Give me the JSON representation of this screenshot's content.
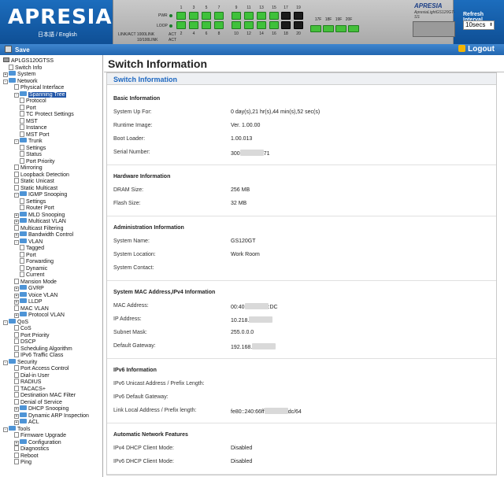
{
  "header": {
    "logo": "APRESIA",
    "language": "日本語 / English",
    "refresh_label": "Refresh Interval",
    "refresh_value": "10secs"
  },
  "device": {
    "brand": "APRESIA",
    "model": "ApresiaLightGS120GT-SS",
    "pwr_label": "PWR",
    "loop_label": "LOOP",
    "legend_1000": "LINK/ACT 1000LINK",
    "legend_1000_act": "ACT",
    "legend_100": "10/100LINK",
    "legend_100_act": "ACT",
    "port_top": [
      "1",
      "3",
      "5",
      "7",
      "9",
      "11",
      "13",
      "15",
      "17",
      "19"
    ],
    "port_bottom": [
      "2",
      "4",
      "6",
      "8",
      "10",
      "12",
      "14",
      "16",
      "18",
      "20"
    ],
    "sfp_labels": [
      "17F",
      "18F",
      "19F",
      "20F"
    ]
  },
  "toolbar": {
    "save": "Save",
    "logout": "Logout"
  },
  "tree": [
    {
      "label": "APLGS120GTSS",
      "indent": 0,
      "type": "device",
      "expander": ""
    },
    {
      "label": "Switch Info",
      "indent": 1,
      "type": "doc",
      "expander": ""
    },
    {
      "label": "System",
      "indent": 0,
      "type": "folder",
      "expander": "+"
    },
    {
      "label": "Network",
      "indent": 0,
      "type": "folder",
      "expander": "-"
    },
    {
      "label": "Physical Interface",
      "indent": 2,
      "type": "doc",
      "expander": ""
    },
    {
      "label": "Spanning Tree",
      "indent": 2,
      "type": "folder",
      "expander": "-",
      "selected": true
    },
    {
      "label": "Protocol",
      "indent": 3,
      "type": "doc",
      "expander": ""
    },
    {
      "label": "Port",
      "indent": 3,
      "type": "doc",
      "expander": ""
    },
    {
      "label": "TC Protect Settings",
      "indent": 3,
      "type": "doc",
      "expander": ""
    },
    {
      "label": "MST",
      "indent": 3,
      "type": "doc",
      "expander": ""
    },
    {
      "label": "Instance",
      "indent": 3,
      "type": "doc",
      "expander": ""
    },
    {
      "label": "MST Port",
      "indent": 3,
      "type": "doc",
      "expander": ""
    },
    {
      "label": "Trunk",
      "indent": 2,
      "type": "folder",
      "expander": "-"
    },
    {
      "label": "Settings",
      "indent": 3,
      "type": "doc",
      "expander": ""
    },
    {
      "label": "Status",
      "indent": 3,
      "type": "doc",
      "expander": ""
    },
    {
      "label": "Port Priority",
      "indent": 3,
      "type": "doc",
      "expander": ""
    },
    {
      "label": "Mirroring",
      "indent": 2,
      "type": "doc",
      "expander": ""
    },
    {
      "label": "Loopback Detection",
      "indent": 2,
      "type": "doc",
      "expander": ""
    },
    {
      "label": "Static Unicast",
      "indent": 2,
      "type": "doc",
      "expander": ""
    },
    {
      "label": "Static Multicast",
      "indent": 2,
      "type": "doc",
      "expander": ""
    },
    {
      "label": "IGMP Snooping",
      "indent": 2,
      "type": "folder",
      "expander": "-"
    },
    {
      "label": "Settings",
      "indent": 3,
      "type": "doc",
      "expander": ""
    },
    {
      "label": "Router Port",
      "indent": 3,
      "type": "doc",
      "expander": ""
    },
    {
      "label": "MLD Snooping",
      "indent": 2,
      "type": "folder",
      "expander": "+"
    },
    {
      "label": "Multicast VLAN",
      "indent": 2,
      "type": "folder",
      "expander": "+"
    },
    {
      "label": "Multicast Filtering",
      "indent": 2,
      "type": "doc",
      "expander": ""
    },
    {
      "label": "Bandwidth Control",
      "indent": 2,
      "type": "folder",
      "expander": "+"
    },
    {
      "label": "VLAN",
      "indent": 2,
      "type": "folder",
      "expander": "-"
    },
    {
      "label": "Tagged",
      "indent": 3,
      "type": "doc",
      "expander": ""
    },
    {
      "label": "Port",
      "indent": 3,
      "type": "doc",
      "expander": ""
    },
    {
      "label": "Forwarding",
      "indent": 3,
      "type": "doc",
      "expander": ""
    },
    {
      "label": "Dynamic",
      "indent": 3,
      "type": "doc",
      "expander": ""
    },
    {
      "label": "Current",
      "indent": 3,
      "type": "doc",
      "expander": ""
    },
    {
      "label": "Mansion Mode",
      "indent": 2,
      "type": "doc",
      "expander": ""
    },
    {
      "label": "GVRP",
      "indent": 2,
      "type": "folder",
      "expander": "+"
    },
    {
      "label": "Voice VLAN",
      "indent": 2,
      "type": "folder",
      "expander": "+"
    },
    {
      "label": "LLDP",
      "indent": 2,
      "type": "folder",
      "expander": "+"
    },
    {
      "label": "MAC VLAN",
      "indent": 2,
      "type": "doc",
      "expander": ""
    },
    {
      "label": "Protocol VLAN",
      "indent": 2,
      "type": "folder",
      "expander": "+"
    },
    {
      "label": "QoS",
      "indent": 0,
      "type": "folder",
      "expander": "-"
    },
    {
      "label": "CoS",
      "indent": 2,
      "type": "doc",
      "expander": ""
    },
    {
      "label": "Port Priority",
      "indent": 2,
      "type": "doc",
      "expander": ""
    },
    {
      "label": "DSCP",
      "indent": 2,
      "type": "doc",
      "expander": ""
    },
    {
      "label": "Scheduling Algorithm",
      "indent": 2,
      "type": "doc",
      "expander": ""
    },
    {
      "label": "IPv6 Traffic Class",
      "indent": 2,
      "type": "doc",
      "expander": ""
    },
    {
      "label": "Security",
      "indent": 0,
      "type": "folder",
      "expander": "-"
    },
    {
      "label": "Port Access Control",
      "indent": 2,
      "type": "doc",
      "expander": ""
    },
    {
      "label": "Dial-in User",
      "indent": 2,
      "type": "doc",
      "expander": ""
    },
    {
      "label": "RADIUS",
      "indent": 2,
      "type": "doc",
      "expander": ""
    },
    {
      "label": "TACACS+",
      "indent": 2,
      "type": "doc",
      "expander": ""
    },
    {
      "label": "Destination MAC Filter",
      "indent": 2,
      "type": "doc",
      "expander": ""
    },
    {
      "label": "Denial of Service",
      "indent": 2,
      "type": "doc",
      "expander": ""
    },
    {
      "label": "DHCP Snooping",
      "indent": 2,
      "type": "folder",
      "expander": "+"
    },
    {
      "label": "Dynamic ARP Inspection",
      "indent": 2,
      "type": "folder",
      "expander": "+"
    },
    {
      "label": "ACL",
      "indent": 2,
      "type": "folder",
      "expander": "+"
    },
    {
      "label": "Tools",
      "indent": 0,
      "type": "folder",
      "expander": "-"
    },
    {
      "label": "Firmware Upgrade",
      "indent": 2,
      "type": "doc",
      "expander": ""
    },
    {
      "label": "Configuration",
      "indent": 2,
      "type": "folder",
      "expander": "+"
    },
    {
      "label": "Diagnostics",
      "indent": 2,
      "type": "doc",
      "expander": ""
    },
    {
      "label": "Reboot",
      "indent": 2,
      "type": "doc",
      "expander": ""
    },
    {
      "label": "Ping",
      "indent": 2,
      "type": "doc",
      "expander": ""
    }
  ],
  "main": {
    "page_title": "Switch Information",
    "panel_title": "Switch Information",
    "sections": [
      {
        "title": "Basic Information",
        "rows": [
          {
            "label": "System Up For:",
            "value": "0 day(s),21 hr(s),44 min(s),52 sec(s)"
          },
          {
            "label": "Runtime Image:",
            "value": "Ver. 1.00.00"
          },
          {
            "label": "Boot Loader:",
            "value": "1.00.013"
          },
          {
            "label": "Serial Number:",
            "value": "300",
            "value_after": "71",
            "redacted": true
          }
        ]
      },
      {
        "title": "Hardware Information",
        "rows": [
          {
            "label": "DRAM Size:",
            "value": "256 MB"
          },
          {
            "label": "Flash Size:",
            "value": "32 MB"
          }
        ]
      },
      {
        "title": "Administration Information",
        "rows": [
          {
            "label": "System Name:",
            "value": "GS120GT"
          },
          {
            "label": "System Location:",
            "value": "Work Room"
          },
          {
            "label": "System Contact:",
            "value": ""
          }
        ]
      },
      {
        "title": "System MAC Address,IPv4 Information",
        "rows": [
          {
            "label": "MAC Address:",
            "value": "00:40",
            "value_after": ":DC",
            "redacted": true
          },
          {
            "label": "IP Address:",
            "value": "10.218.",
            "value_after": "",
            "redacted": true
          },
          {
            "label": "Subnet Mask:",
            "value": "255.0.0.0"
          },
          {
            "label": "Default Gateway:",
            "value": "192.168.",
            "value_after": "",
            "redacted": true
          }
        ]
      },
      {
        "title": "IPv6 Information",
        "rows": [
          {
            "label": "IPv6 Unicast Address / Prefix Length:",
            "value": ""
          },
          {
            "label": "IPv6 Default Gateway:",
            "value": ""
          },
          {
            "label": "Link Local Address / Prefix length:",
            "value": "fe80::240:66ff",
            "value_after": "dc/64",
            "redacted": true
          }
        ]
      },
      {
        "title": "Automatic Network Features",
        "rows": [
          {
            "label": "IPv4 DHCP Client Mode:",
            "value": "Disabled"
          },
          {
            "label": "IPv6 DHCP Client Mode:",
            "value": "Disabled"
          }
        ]
      }
    ]
  }
}
